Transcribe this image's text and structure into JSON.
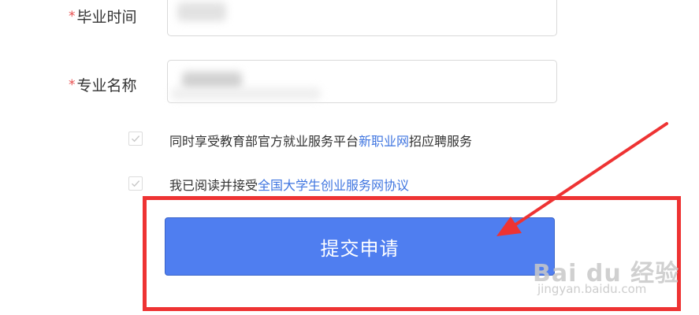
{
  "form": {
    "graduation_time": {
      "required_mark": "*",
      "label": "毕业时间"
    },
    "major_name": {
      "required_mark": "*",
      "label": "专业名称"
    },
    "agreements": [
      {
        "checked": true,
        "text_before": "同时享受教育部官方就业服务平台",
        "link_text": "新职业网",
        "text_after": "招应聘服务"
      },
      {
        "checked": true,
        "text_before": "我已阅读并接受",
        "link_text": "全国大学生创业服务网协议",
        "text_after": ""
      }
    ],
    "submit_label": "提交申请"
  },
  "colors": {
    "primary_button": "#4f7ef0",
    "link": "#3f75e0",
    "required_star": "#e84e4e",
    "annotation_red": "#ee3333"
  },
  "watermark": {
    "logo": "Bai du 经验",
    "subtitle": "jingyan.baidu.com"
  }
}
